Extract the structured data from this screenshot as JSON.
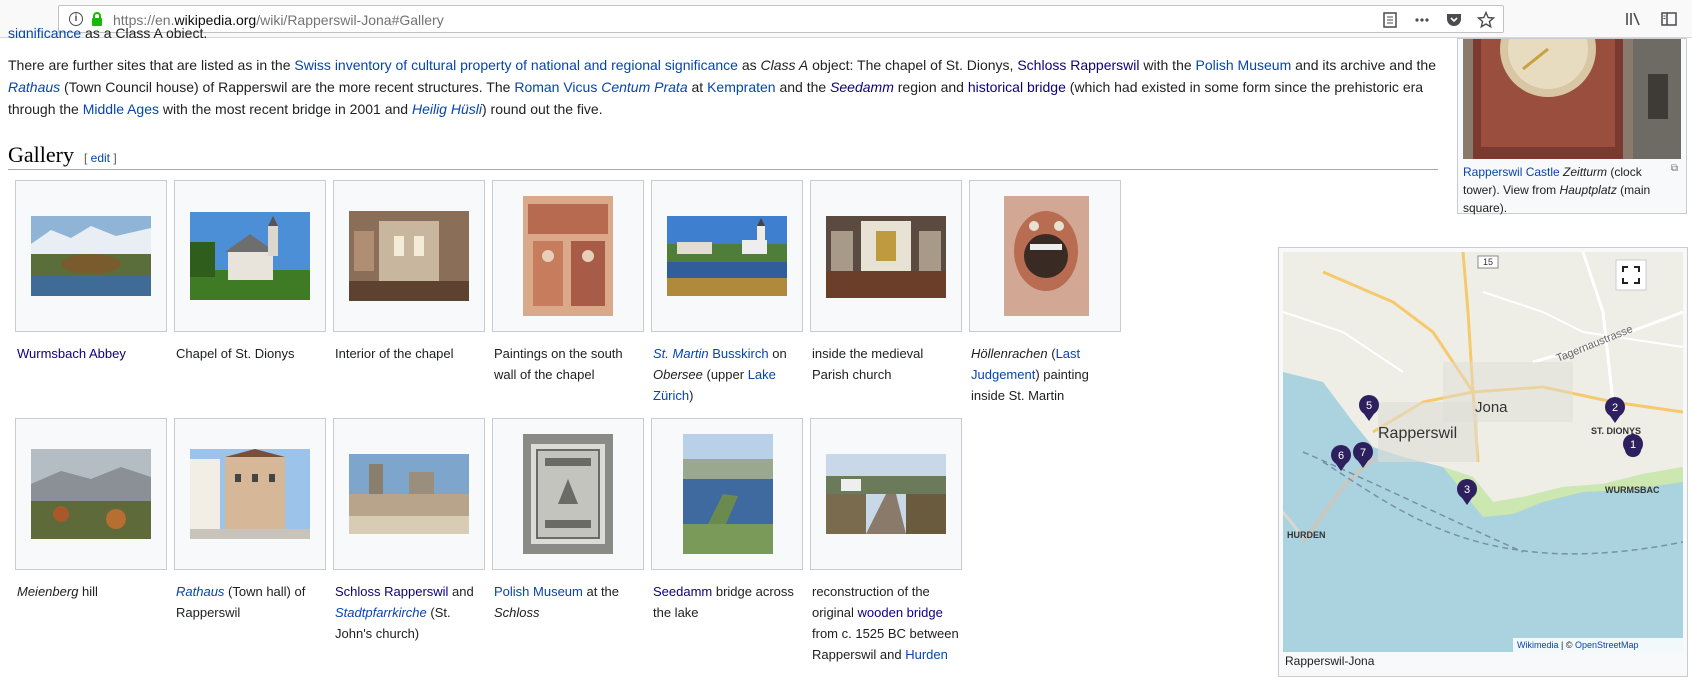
{
  "browser": {
    "url_prefix": "https://en.",
    "url_domain": "wikipedia.org",
    "url_path": "/wiki/Rapperswil-Jona#Gallery"
  },
  "article": {
    "partial_top_link": "significance",
    "partial_top_text": " as a Class A object.",
    "p1": "There are further sites that are listed as in the ",
    "l_swiss_inventory": "Swiss inventory of cultural property of national and regional significance",
    "p2": " as ",
    "p3_italic": "Class A",
    "p4": " object: The chapel of St. Dionys, ",
    "l_schloss": "Schloss Rapperswil",
    "p5": " with the ",
    "l_polish": "Polish Museum",
    "p6": " and its archive and the ",
    "l_rathaus": "Rathaus",
    "p7": " (Town Council house) of Rapperswil are the more recent structures. The ",
    "l_roman": "Roman Vicus ",
    "l_centum": "Centum Prata",
    "p8": " at ",
    "l_kempraten": "Kempraten",
    "p9": " and the ",
    "l_seedamm": "Seedamm",
    "p10": " region and ",
    "l_bridge": "historical bridge",
    "p11": " (which had existed in some form since the prehistoric era through the ",
    "l_middle": "Middle Ages",
    "p12": " with the most recent bridge in 2001 and ",
    "l_heilig": "Heilig Hüsli",
    "p13": ") round out the five."
  },
  "gallery": {
    "heading": "Gallery",
    "edit_open": "[ ",
    "edit_link": "edit",
    "edit_close": " ]",
    "captions": {
      "c1_link": "Wurmsbach Abbey",
      "c2": "Chapel of St. Dionys",
      "c3": "Interior of the chapel",
      "c4": "Paintings on the south wall of the chapel",
      "c5_l1": "St. Martin",
      "c5_l2": "Busskirch",
      "c5_t1": " on ",
      "c5_i1": "Obersee",
      "c5_t2": " (upper ",
      "c5_l3": "Lake Zürich",
      "c5_t3": ")",
      "c6": "inside the medieval Parish church",
      "c7_i": "Höllenrachen",
      "c7_t1": " (",
      "c7_l": "Last Judgement",
      "c7_t2": ") painting inside St. Martin",
      "c8_i": "Meienberg",
      "c8_t": " hill",
      "c9_l": "Rathaus",
      "c9_t": " (Town hall) of Rapperswil",
      "c10_l1": "Schloss Rapperswil",
      "c10_t1": " and ",
      "c10_l2": "Stadtpfarrkirche",
      "c10_t2": " (St. John's church)",
      "c11_l": "Polish Museum",
      "c11_t": " at the ",
      "c11_i": "Schloss",
      "c12_l": "Seedamm",
      "c12_t": " bridge across the lake",
      "c13_t1": "reconstruction of the original ",
      "c13_l1": "wooden bridge",
      "c13_t2": " from c. 1525 BC between Rapperswil and ",
      "c13_l2": "Hurden"
    }
  },
  "sidebar": {
    "caption_link": "Rapperswil Castle",
    "caption_i1": " Zeitturm",
    "caption_t1": " (clock tower). View from ",
    "caption_i2": "Hauptplatz",
    "caption_t2": " (main square)."
  },
  "map": {
    "caption": "Rapperswil-Jona",
    "label_jona": "Jona",
    "label_rapperswil": "Rapperswil",
    "label_st_dionys": "ST. DIONYS",
    "label_wurmsbach": "WURMSBAC",
    "label_hurden": "HURDEN",
    "label_road": "Tagernaustrasse",
    "label_route": "15",
    "markers": [
      "1",
      "2",
      "3",
      "5",
      "6",
      "7"
    ],
    "attribution_wikimedia": "Wikimedia",
    "attribution_sep": " | © ",
    "attribution_osm": "OpenStreetMap",
    "water_color": "#aad3df",
    "marker_color": "#2e1f5e"
  }
}
